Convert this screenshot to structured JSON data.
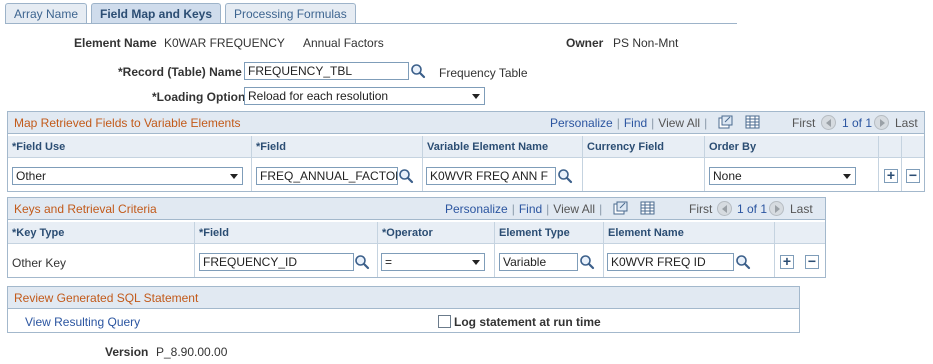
{
  "tabs": [
    "Array Name",
    "Field Map and Keys",
    "Processing Formulas"
  ],
  "element": {
    "label": "Element Name",
    "name": "K0WAR FREQUENCY",
    "description": "Annual Factors",
    "owner_label": "Owner",
    "owner": "PS Non-Mnt"
  },
  "record": {
    "label": "*Record (Table) Name",
    "value": "FREQUENCY_TBL",
    "description": "Frequency Table"
  },
  "loading": {
    "label": "*Loading Option",
    "value": "Reload for each resolution"
  },
  "map_section": {
    "title": "Map Retrieved Fields to Variable Elements",
    "personalize": "Personalize",
    "find": "Find",
    "view_all": "View All",
    "first": "First",
    "pager": "1 of 1",
    "last": "Last",
    "headers": [
      "*Field Use",
      "*Field",
      "Variable Element Name",
      "Currency Field",
      "Order By"
    ],
    "row": {
      "field_use": "Other",
      "field": "FREQ_ANNUAL_FACTOR",
      "variable_element": "K0WVR FREQ ANN F",
      "currency": "",
      "order_by": "None"
    }
  },
  "keys_section": {
    "title": "Keys and Retrieval Criteria",
    "personalize": "Personalize",
    "find": "Find",
    "view_all": "View All",
    "first": "First",
    "pager": "1 of 1",
    "last": "Last",
    "headers": [
      "*Key Type",
      "*Field",
      "*Operator",
      "Element Type",
      "Element Name"
    ],
    "row": {
      "key_type": "Other Key",
      "field": "FREQUENCY_ID",
      "operator": "=",
      "element_type": "Variable",
      "element_name": "K0WVR FREQ ID"
    }
  },
  "sql_section": {
    "title": "Review Generated SQL Statement",
    "view_query": "View Resulting Query",
    "log_label": "Log statement at run time"
  },
  "version": {
    "label": "Version",
    "value": "P_8.90.00.00"
  },
  "buttons": {
    "add": "+",
    "remove": "−"
  }
}
